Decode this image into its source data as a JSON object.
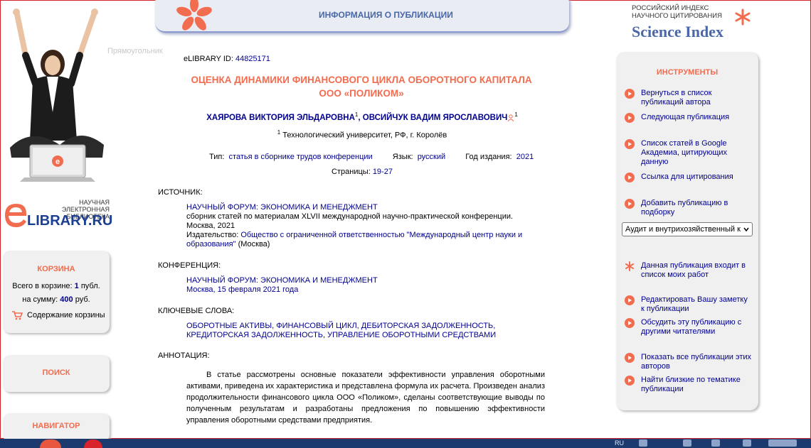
{
  "header": {
    "title": "ИНФОРМАЦИЯ О ПУБЛИКАЦИИ",
    "ghost_label": "Прямоугольник"
  },
  "brand": {
    "elib_tagline_1": "НАУЧНАЯ ЭЛЕКТРОННАЯ",
    "elib_tagline_2": "БИБЛИОТЕКА",
    "elib_name": "LIBRARY.RU",
    "rinc_line_1": "РОССИЙСКИЙ ИНДЕКС",
    "rinc_line_2": "НАУЧНОГО ЦИТИРОВАНИЯ",
    "rinc_name": "Science Index",
    "accent_color": "#f26c4f",
    "link_color": "#00008f"
  },
  "cart": {
    "title": "КОРЗИНА",
    "count_prefix": "Всего в корзине:",
    "count_value": "1",
    "count_unit": "публ.",
    "sum_prefix": "на сумму:",
    "sum_value": "400",
    "sum_unit": "руб.",
    "contents_label": "Содержание корзины"
  },
  "search": {
    "title": "ПОИСК"
  },
  "navigator": {
    "title": "НАВИГАТОР"
  },
  "publication": {
    "id_label": "eLIBRARY ID:",
    "id_value": "44825171",
    "title_line1": "ОЦЕНКА ДИНАМИКИ ФИНАНСОВОГО ЦИКЛА ОБОРОТНОГО КАПИТАЛА",
    "title_line2": "ООО «ПОЛИКОМ»",
    "author1": "ХАЯРОВА ВИКТОРИЯ ЭЛЬДАРОВНА",
    "author1_sup": "1",
    "author_sep": ",",
    "author2": "ОВСИЙЧУК ВАДИМ ЯРОСЛАВОВИЧ",
    "author2_sup": "1",
    "affil_sup": "1",
    "affiliation": "Технологический университет, РФ, г. Королёв",
    "type_label": "Тип:",
    "type_value": "статья в сборнике трудов конференции",
    "lang_label": "Язык:",
    "lang_value": "русский",
    "year_label": "Год издания:",
    "year_value": "2021",
    "pages_label": "Страницы:",
    "pages_value": "19-27",
    "source_label": "ИСТОЧНИК:",
    "source_title": "НАУЧНЫЙ ФОРУМ: ЭКОНОМИКА И МЕНЕДЖМЕНТ",
    "source_desc": "сборник статей по материалам XLVII международной научно-практической конференции. Москва, 2021",
    "publisher_label": "Издательство:",
    "publisher_value": "Общество с ограниченной ответственностью \"Международный центр науки и образования\"",
    "publisher_city": "(Москва)",
    "conf_label": "КОНФЕРЕНЦИЯ:",
    "conf_title": "НАУЧНЫЙ ФОРУМ: ЭКОНОМИКА И МЕНЕДЖМЕНТ",
    "conf_place": "Москва, 15 февраля 2021 года",
    "keywords_label": "КЛЮЧЕВЫЕ СЛОВА:",
    "keywords": "ОБОРОТНЫЕ АКТИВЫ, ФИНАНСОВЫЙ ЦИКЛ, ДЕБИТОРСКАЯ ЗАДОЛЖЕННОСТЬ, КРЕДИТОРСКАЯ ЗАДОЛЖЕННОСТЬ, УПРАВЛЕНИЕ ОБОРОТНЫМИ СРЕДСТВАМИ",
    "abstract_label": "АННОТАЦИЯ:",
    "abstract": "В статье рассмотрены основные показатели эффективности управления оборотными активами, приведена их характеристика и представлена формула их расчета. Произведен анализ продолжительности финансового цикла ООО «Поликом», сделаны соответствующие выводы по полученным результатам и разработаны предложения по повышению эффективности управления оборотными средствами предприятия."
  },
  "tools": {
    "title": "ИНСТРУМЕНТЫ",
    "items": [
      {
        "label": "Вернуться в список публикаций автора",
        "icon": "arrow-circle-icon"
      },
      {
        "label": "Следующая публикация",
        "icon": "arrow-circle-icon"
      },
      {
        "label": "Список статей в Google Академиа, цитирующих данную",
        "icon": "arrow-circle-icon"
      },
      {
        "label": "Ссылка для цитирования",
        "icon": "arrow-circle-icon"
      },
      {
        "label": "Добавить публикацию в подборку",
        "icon": "arrow-circle-icon"
      },
      {
        "label": "Данная публикация входит в список моих работ",
        "icon": "asterisk-icon"
      },
      {
        "label": "Редактировать Вашу заметку к публикации",
        "icon": "arrow-circle-icon"
      },
      {
        "label": "Обсудить эту публикацию с другими читателями",
        "icon": "arrow-circle-icon"
      },
      {
        "label": "Показать все публикации этих авторов",
        "icon": "arrow-circle-icon"
      },
      {
        "label": "Найти близкие по тематике публикации",
        "icon": "arrow-circle-icon"
      }
    ],
    "collection_select": "Аудит и внутрихозяйственный к"
  },
  "taskbar": {
    "tray_lang": "RU"
  }
}
